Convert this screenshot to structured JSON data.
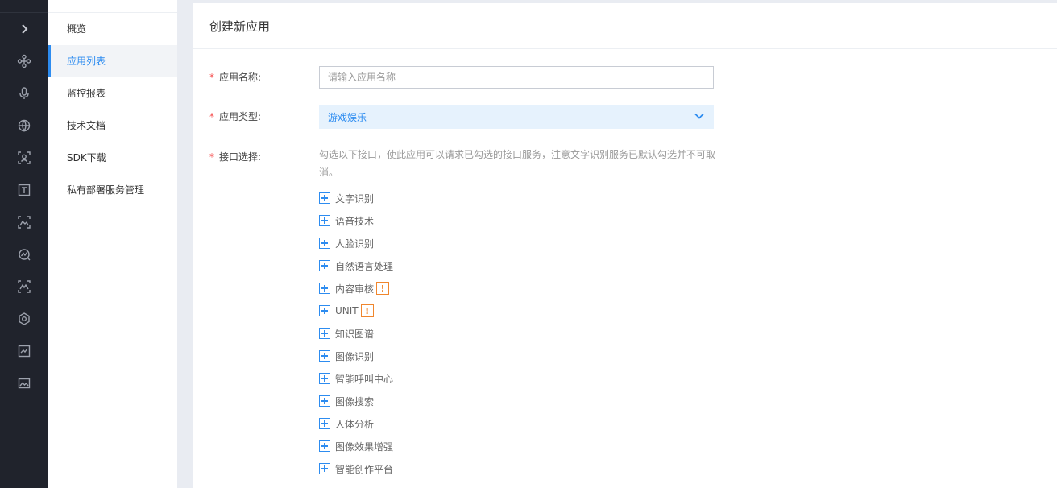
{
  "rail": {
    "icons": [
      "chevron-right-icon",
      "nodes-icon",
      "microphone-icon",
      "globe-icon",
      "face-scan-icon",
      "text-box-icon",
      "image-scan-icon",
      "analytics-icon",
      "image-scan-alt-icon",
      "hexagon-icon",
      "chart-board-icon",
      "image-frame-icon"
    ]
  },
  "sidenav": {
    "items": [
      {
        "label": "概览"
      },
      {
        "label": "应用列表"
      },
      {
        "label": "监控报表"
      },
      {
        "label": "技术文档"
      },
      {
        "label": "SDK下载"
      },
      {
        "label": "私有部署服务管理"
      }
    ]
  },
  "page": {
    "title": "创建新应用"
  },
  "form": {
    "required_mark": "*",
    "name_label": "应用名称:",
    "name_placeholder": "请输入应用名称",
    "name_value": "",
    "type_label": "应用类型:",
    "type_value": "游戏娱乐",
    "api_label": "接口选择:",
    "api_description": "勾选以下接口，使此应用可以请求已勾选的接口服务，注意文字识别服务已默认勾选并不可取消。",
    "api_items": [
      {
        "label": "文字识别",
        "warning": ""
      },
      {
        "label": "语音技术",
        "warning": ""
      },
      {
        "label": "人脸识别",
        "warning": ""
      },
      {
        "label": "自然语言处理",
        "warning": ""
      },
      {
        "label": "内容审核",
        "warning": "!"
      },
      {
        "label": "UNIT",
        "warning": "!"
      },
      {
        "label": "知识图谱",
        "warning": ""
      },
      {
        "label": "图像识别",
        "warning": ""
      },
      {
        "label": "智能呼叫中心",
        "warning": ""
      },
      {
        "label": "图像搜索",
        "warning": ""
      },
      {
        "label": "人体分析",
        "warning": ""
      },
      {
        "label": "图像效果增强",
        "warning": ""
      },
      {
        "label": "智能创作平台",
        "warning": ""
      }
    ]
  },
  "colors": {
    "accent": "#2d8cf0",
    "required": "#f54c4c",
    "warning": "#f0862d",
    "rail_bg": "#20232c"
  }
}
